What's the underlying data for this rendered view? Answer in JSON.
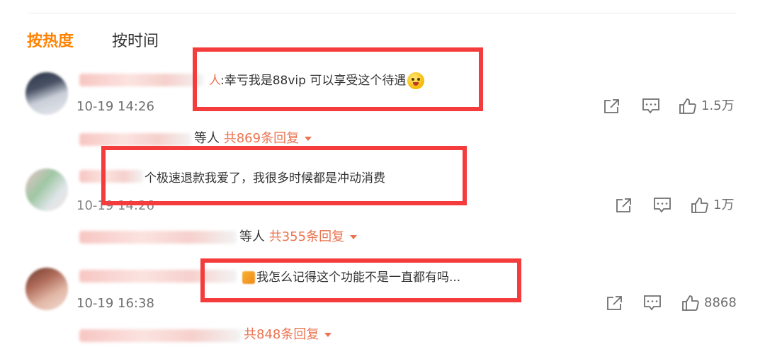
{
  "sort_tabs": {
    "hot": "按热度",
    "time": "按时间"
  },
  "comments": [
    {
      "name_tail": "人",
      "text": ":幸亏我是88vip 可以享受这个待遇",
      "time": "10-19 14:26",
      "likes": "1.5万",
      "reply_people": "等人",
      "reply_link": "共869条回复"
    },
    {
      "name_tail": "",
      "text": "个极速退款我爱了，我很多时候都是冲动消费",
      "time": "10-19 14:26",
      "likes": "1万",
      "reply_people": "等人",
      "reply_link": "共355条回复"
    },
    {
      "name_tail": "",
      "text": "我怎么记得这个功能不是一直都有吗...",
      "time": "10-19 16:38",
      "likes": "8868",
      "reply_people": "",
      "reply_link": "共848条回复"
    }
  ],
  "icons": {
    "share": "share-icon",
    "comment": "comment-icon",
    "like": "thumbs-up-icon",
    "dropdown": "caret-down-icon"
  },
  "colors": {
    "accent_orange": "#ff8200",
    "link_orange": "#eb7350",
    "highlight_red": "#f43c3c",
    "muted_text": "#6f6f6f"
  }
}
